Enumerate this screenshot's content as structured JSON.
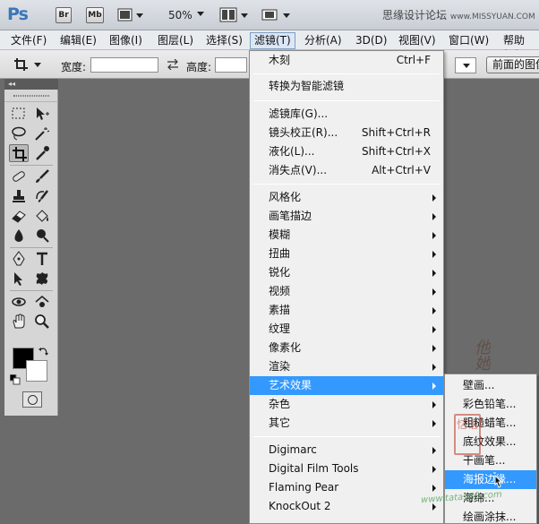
{
  "appbar": {
    "logo": "Ps",
    "bridge_label": "Br",
    "minibridge_label": "Mb",
    "zoom": "50%",
    "watermark_text": "思缘设计论坛",
    "watermark_url": "www.MISSYUAN.COM"
  },
  "menubar": {
    "items": [
      {
        "label": "文件(F)"
      },
      {
        "label": "编辑(E)"
      },
      {
        "label": "图像(I)"
      },
      {
        "label": "图层(L)"
      },
      {
        "label": "选择(S)"
      },
      {
        "label": "滤镜(T)"
      },
      {
        "label": "分析(A)"
      },
      {
        "label": "3D(D)"
      },
      {
        "label": "视图(V)"
      },
      {
        "label": "窗口(W)"
      },
      {
        "label": "帮助(H)"
      }
    ]
  },
  "options": {
    "width_label": "宽度:",
    "height_label": "高度:",
    "width_value": "",
    "height_value": "",
    "front_image_button": "前面的图像"
  },
  "toolbox": {
    "header": "◂◂",
    "foreground_color": "#000000",
    "background_color": "#ffffff"
  },
  "filter_menu": {
    "items": [
      {
        "label": "木刻",
        "shortcut": "Ctrl+F"
      },
      {
        "label": "转换为智能滤镜"
      },
      {
        "label": "滤镜库(G)..."
      },
      {
        "label": "镜头校正(R)...",
        "shortcut": "Shift+Ctrl+R"
      },
      {
        "label": "液化(L)...",
        "shortcut": "Shift+Ctrl+X"
      },
      {
        "label": "消失点(V)...",
        "shortcut": "Alt+Ctrl+V"
      },
      {
        "label": "风格化"
      },
      {
        "label": "画笔描边"
      },
      {
        "label": "模糊"
      },
      {
        "label": "扭曲"
      },
      {
        "label": "锐化"
      },
      {
        "label": "视频"
      },
      {
        "label": "素描"
      },
      {
        "label": "纹理"
      },
      {
        "label": "像素化"
      },
      {
        "label": "渲染"
      },
      {
        "label": "艺术效果"
      },
      {
        "label": "杂色"
      },
      {
        "label": "其它"
      },
      {
        "label": "Digimarc"
      },
      {
        "label": "Digital Film Tools"
      },
      {
        "label": "Flaming Pear"
      },
      {
        "label": "KnockOut 2"
      }
    ]
  },
  "submenu": {
    "items": [
      {
        "label": "壁画..."
      },
      {
        "label": "彩色铅笔..."
      },
      {
        "label": "粗糙蜡笔..."
      },
      {
        "label": "底纹效果..."
      },
      {
        "label": "干画笔..."
      },
      {
        "label": "海报边缘..."
      },
      {
        "label": "海绵..."
      },
      {
        "label": "绘画涂抹..."
      }
    ]
  },
  "watermark": {
    "calligraphy": "他她",
    "seal": "忆语",
    "site": "www.tata580.com"
  }
}
